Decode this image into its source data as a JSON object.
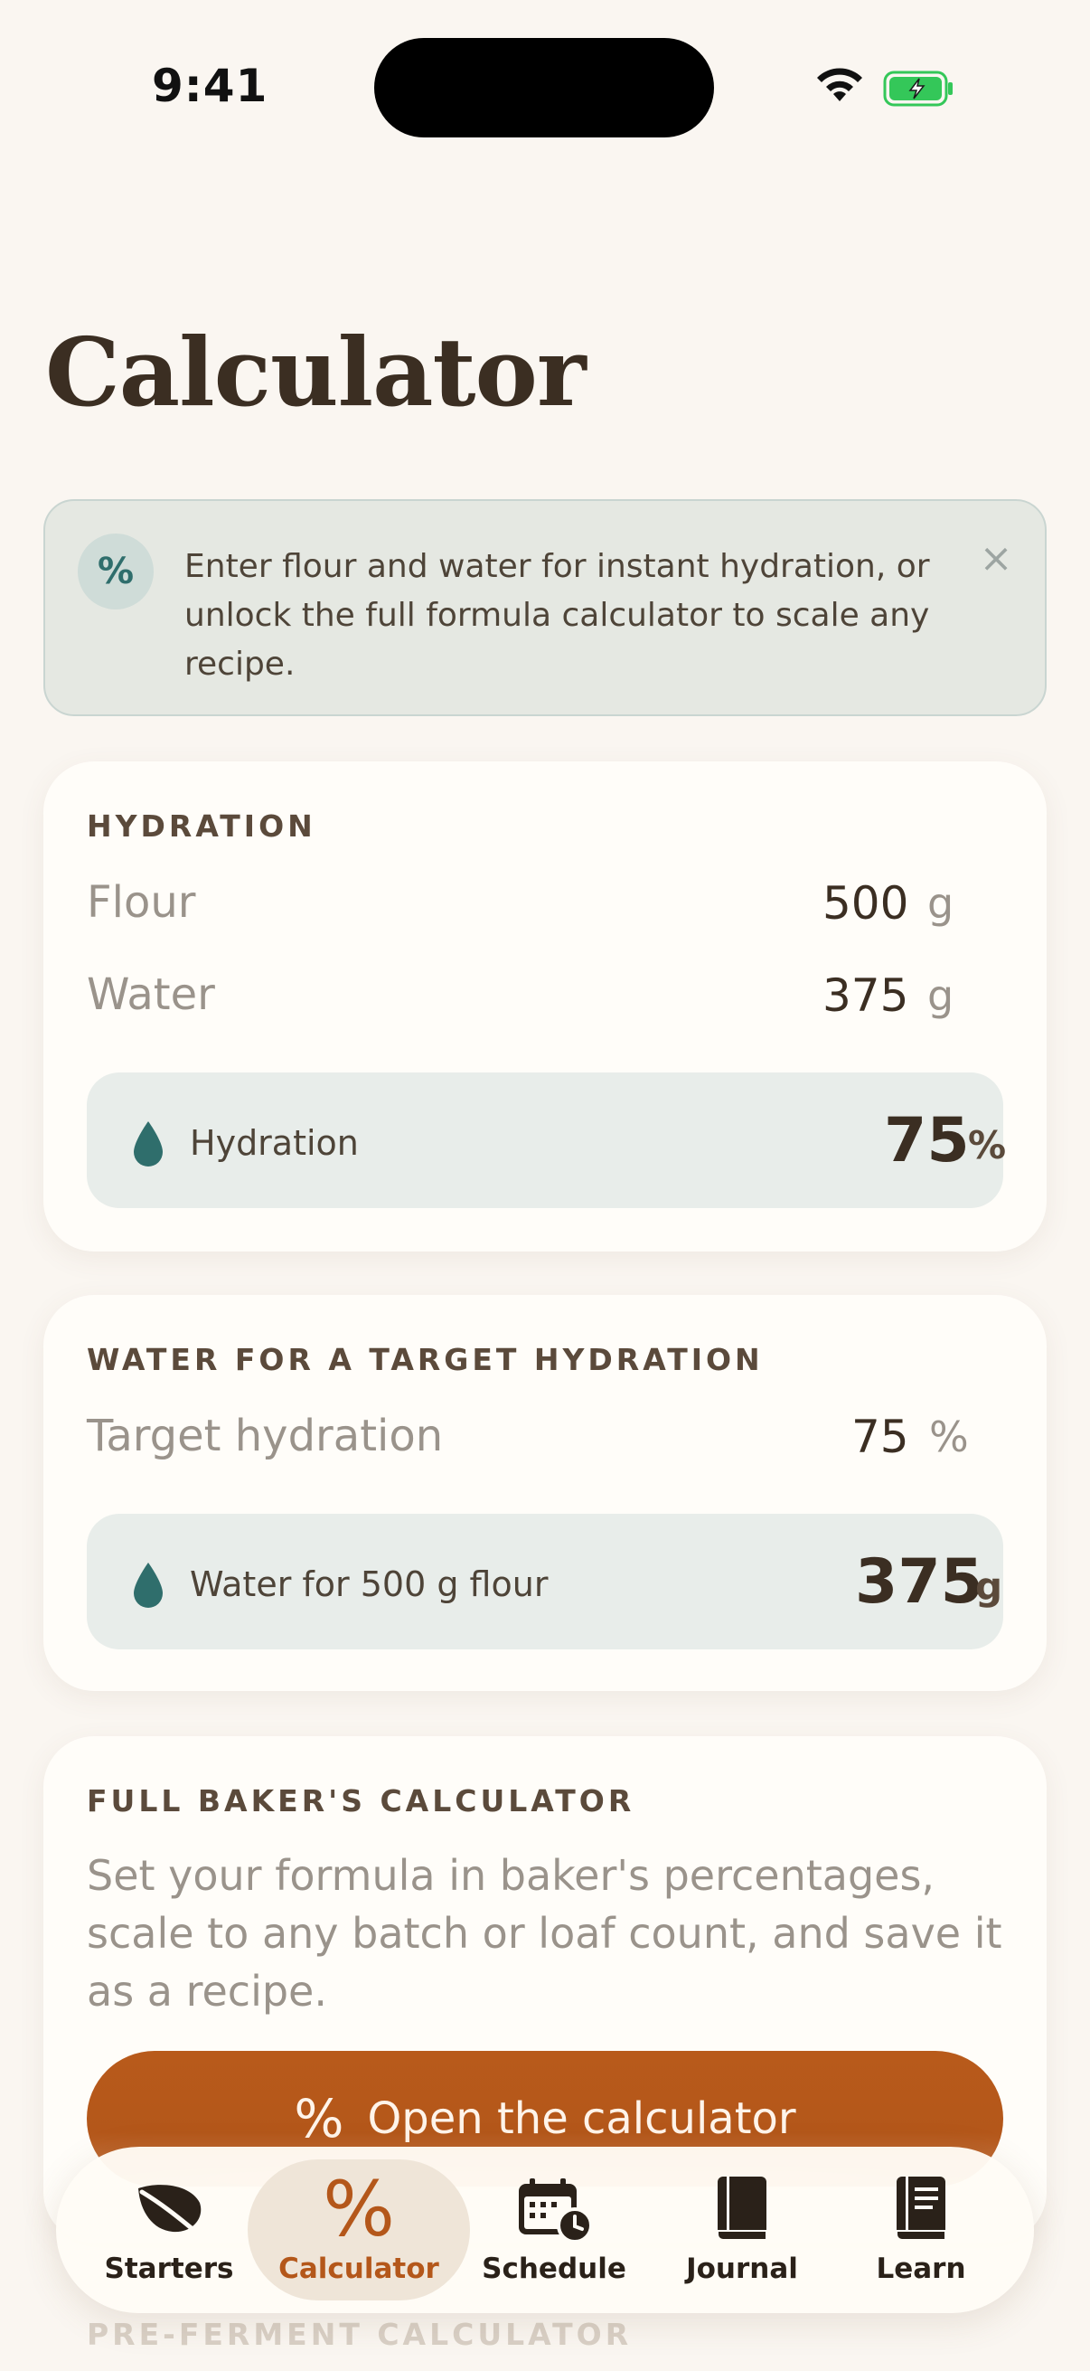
{
  "status_bar": {
    "time": "9:41"
  },
  "title": "Calculator",
  "banner": {
    "icon": "percent-icon",
    "icon_glyph": "%",
    "text": "Enter flour and water for instant hydration, or unlock the full formula calculator to scale any recipe."
  },
  "hydration_card": {
    "heading": "HYDRATION",
    "flour_label": "Flour",
    "flour_value": "500",
    "flour_unit": "g",
    "water_label": "Water",
    "water_value": "375",
    "water_unit": "g",
    "result_label": "Hydration",
    "result_value": "75",
    "result_unit": "%"
  },
  "target_card": {
    "heading": "WATER FOR A TARGET HYDRATION",
    "target_label": "Target hydration",
    "target_value": "75",
    "target_unit": "%",
    "result_label": "Water for 500 g flour",
    "result_value": "375",
    "result_unit": "g"
  },
  "full_card": {
    "heading": "FULL BAKER'S CALCULATOR",
    "description": "Set your formula in baker's percentages, scale to any batch or loaf count, and save it as a recipe.",
    "button_icon": "%",
    "button_label": "Open the calculator"
  },
  "next_section_heading": "PRE-FERMENT CALCULATOR",
  "tabbar": {
    "tabs": [
      {
        "label": "Starters",
        "icon": "leaf-icon"
      },
      {
        "label": "Calculator",
        "icon": "percent-icon",
        "active": true
      },
      {
        "label": "Schedule",
        "icon": "calendar-clock-icon"
      },
      {
        "label": "Journal",
        "icon": "book-icon"
      },
      {
        "label": "Learn",
        "icon": "document-book-icon"
      }
    ],
    "calculator_glyph": "%"
  },
  "colors": {
    "background": "#FAF6F1",
    "accent": "#B4571A",
    "teal": "#2F6E6C",
    "text_primary": "#3B2E22"
  }
}
